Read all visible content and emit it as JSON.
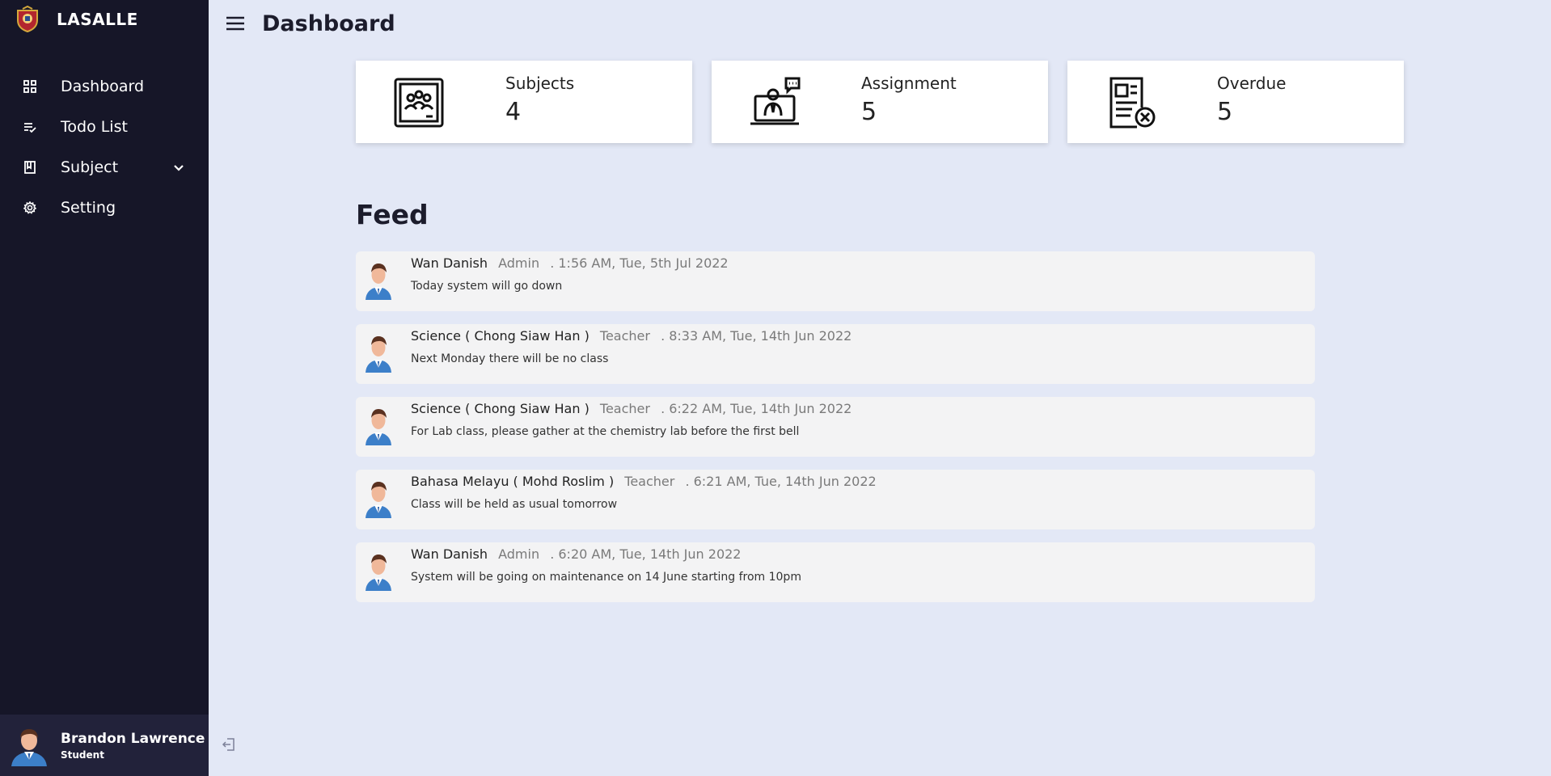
{
  "app": {
    "brand": "LASALLE"
  },
  "header": {
    "title": "Dashboard"
  },
  "sidebar": {
    "items": [
      {
        "label": "Dashboard",
        "icon": "grid-icon"
      },
      {
        "label": "Todo List",
        "icon": "list-check-icon"
      },
      {
        "label": "Subject",
        "icon": "book-icon",
        "expandable": true
      },
      {
        "label": "Setting",
        "icon": "gear-icon"
      }
    ]
  },
  "user": {
    "name": "Brandon Lawrence",
    "role": "Student"
  },
  "stats": [
    {
      "label": "Subjects",
      "value": "4",
      "icon": "classroom-icon"
    },
    {
      "label": "Assignment",
      "value": "5",
      "icon": "online-teacher-icon"
    },
    {
      "label": "Overdue",
      "value": "5",
      "icon": "document-cancel-icon"
    }
  ],
  "feed": {
    "title": "Feed",
    "items": [
      {
        "author": "Wan Danish",
        "role": "Admin",
        "time": ". 1:56 AM, Tue, 5th Jul 2022",
        "message": "Today system will go down"
      },
      {
        "author": "Science ( Chong Siaw Han )",
        "role": "Teacher",
        "time": ". 8:33 AM, Tue, 14th Jun 2022",
        "message": "Next Monday there will be no class"
      },
      {
        "author": "Science ( Chong Siaw Han )",
        "role": "Teacher",
        "time": ". 6:22 AM, Tue, 14th Jun 2022",
        "message": "For Lab class, please gather at the chemistry lab before the first bell"
      },
      {
        "author": "Bahasa Melayu ( Mohd Roslim )",
        "role": "Teacher",
        "time": ". 6:21 AM, Tue, 14th Jun 2022",
        "message": "Class will be held as usual tomorrow"
      },
      {
        "author": "Wan Danish",
        "role": "Admin",
        "time": ". 6:20 AM, Tue, 14th Jun 2022",
        "message": "System will be going on maintenance on 14 June starting from 10pm"
      }
    ]
  },
  "colors": {
    "sidebar": "#161628",
    "user_bar": "#22223a",
    "background": "#e3e8f6",
    "card": "#ffffff",
    "feed_item": "#f3f3f4"
  }
}
